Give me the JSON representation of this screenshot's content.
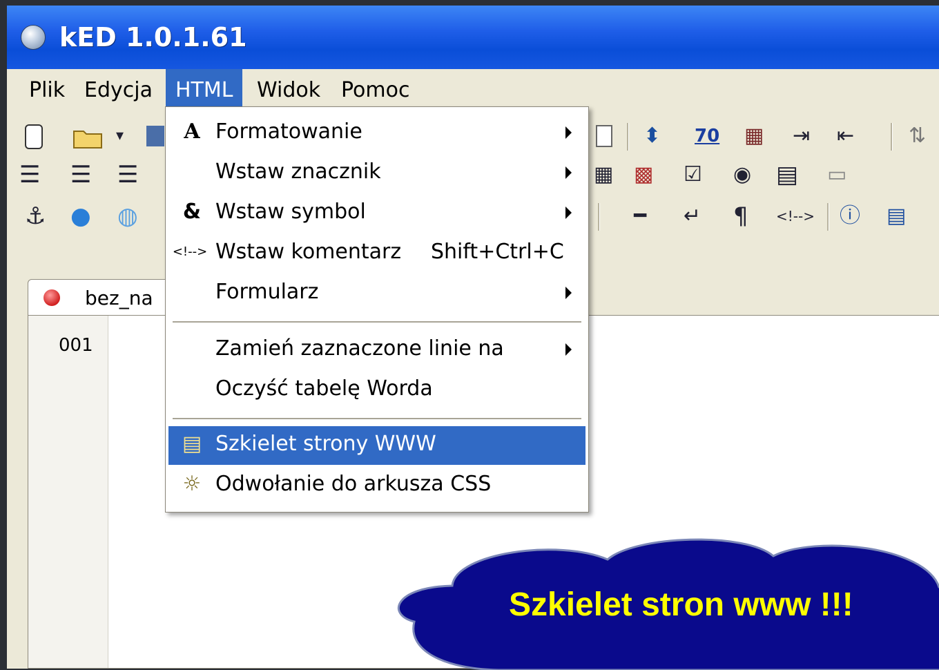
{
  "window": {
    "title": "kED 1.0.1.61"
  },
  "menubar": {
    "items": [
      "Plik",
      "Edycja",
      "HTML",
      "Widok",
      "Pomoc"
    ],
    "active": "HTML"
  },
  "toolbar": {
    "numeric_button": "70",
    "comment_button": "<!-->"
  },
  "tab": {
    "label": "bez_na"
  },
  "editor": {
    "first_line_number": "001"
  },
  "html_menu": {
    "items": [
      {
        "icon": "A",
        "icon_name": "font-a-icon",
        "label": "Formatowanie",
        "shortcut": "",
        "submenu": true
      },
      {
        "icon": "",
        "icon_name": "",
        "label": "Wstaw znacznik",
        "shortcut": "",
        "submenu": true
      },
      {
        "icon": "&",
        "icon_name": "ampersand-icon",
        "label": "Wstaw symbol",
        "shortcut": "",
        "submenu": true
      },
      {
        "icon": "<!-->",
        "icon_name": "comment-icon",
        "label": "Wstaw komentarz",
        "shortcut": "Shift+Ctrl+C",
        "submenu": false
      },
      {
        "icon": "",
        "icon_name": "",
        "label": "Formularz",
        "shortcut": "",
        "submenu": true
      },
      {
        "icon": "",
        "icon_name": "",
        "label": "Zamień zaznaczone linie na",
        "shortcut": "",
        "submenu": true
      },
      {
        "icon": "",
        "icon_name": "",
        "label": "Oczyść tabelę Worda",
        "shortcut": "",
        "submenu": false
      },
      {
        "icon": "▤",
        "icon_name": "page-skeleton-icon",
        "label": "Szkielet strony WWW",
        "shortcut": "",
        "submenu": false,
        "highlighted": true
      },
      {
        "icon": "☼",
        "icon_name": "css-sheet-icon",
        "label": "Odwołanie do arkusza CSS",
        "shortcut": "",
        "submenu": false
      }
    ]
  },
  "callout": {
    "text": "Szkielet stron www !!!",
    "fill_color": "#0a0a8c",
    "text_color": "#ffff00"
  }
}
